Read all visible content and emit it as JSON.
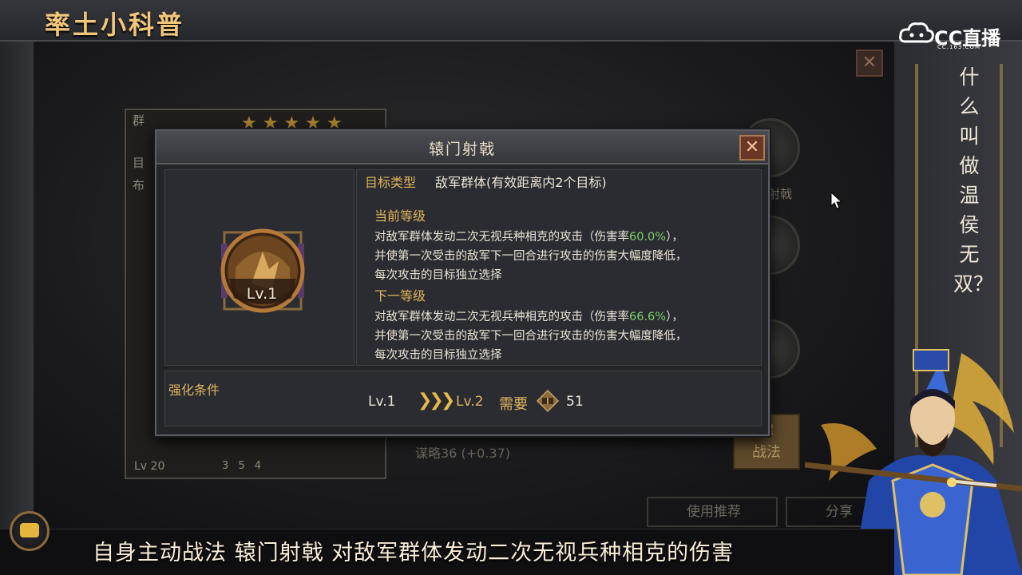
{
  "banner": {
    "title": "率土小科普"
  },
  "stream_logo": {
    "brand": "CC直播",
    "domain": "CC.163.COM"
  },
  "side_caption": {
    "text": "什么叫做温侯无双？"
  },
  "background_card": {
    "name_char": "群",
    "info_tags": [
      "目",
      "布"
    ],
    "stars": "★★★★★",
    "level": "Lv 20",
    "stats": "3  5  4"
  },
  "background_misc": {
    "slot_label": "射戟",
    "strategy": "谋略36  (+0.37)",
    "unlock_label": "解\n战法",
    "recommend_label": "使用推荐",
    "share_label": "分享"
  },
  "modal": {
    "title": "辕门射戟",
    "close_glyph": "✕",
    "skill_level": "Lv.1",
    "target_label": "目标类型",
    "target_value": "敌军群体(有效距离内2个目标)",
    "current": {
      "title": "当前等级",
      "line1_pre": "对敌军群体发动二次无视兵种相克的攻击（伤害率",
      "rate": "60.0%",
      "line1_post": "），",
      "line2": "并使第一次受击的敌军下一回合进行攻击的伤害大幅度降低，",
      "line3": "每次攻击的目标独立选择"
    },
    "next": {
      "title": "下一等级",
      "line1_pre": "对敌军群体发动二次无视兵种相克的攻击（伤害率",
      "rate": "66.6%",
      "line1_post": "），",
      "line2": "并使第一次受击的敌军下一回合进行攻击的伤害大幅度降低，",
      "line3": "每次攻击的目标独立选择"
    },
    "upgrade": {
      "label": "强化条件",
      "from_level": "Lv.1",
      "arrows": "❯❯❯",
      "to_level": "Lv.2",
      "need_label": "需要",
      "need_count": "51"
    }
  },
  "subtitle": {
    "text": "自身主动战法 辕门射戟 对敌军群体发动二次无视兵种相克的伤害"
  },
  "colors": {
    "accent_gold": "#e0b45c",
    "rate_green": "#7fd06a",
    "close_red": "#6a3626"
  }
}
